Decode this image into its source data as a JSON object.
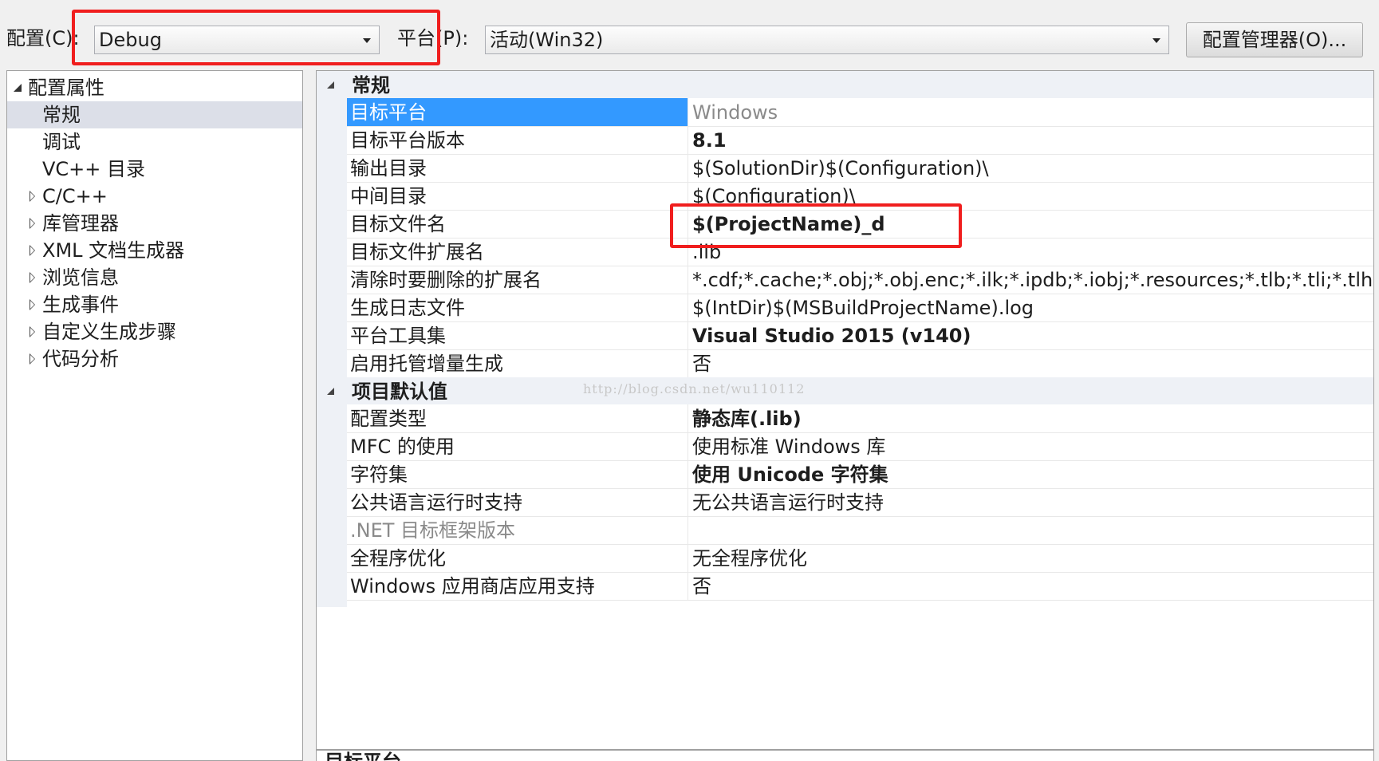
{
  "toolbar": {
    "config_label": "配置(C):",
    "config_value": "Debug",
    "platform_label": "平台(P):",
    "platform_value": "活动(Win32)",
    "config_manager_button": "配置管理器(O)..."
  },
  "tree": {
    "root": "配置属性",
    "items": [
      {
        "label": "常规",
        "expandable": false,
        "selected": true
      },
      {
        "label": "调试",
        "expandable": false
      },
      {
        "label": "VC++ 目录",
        "expandable": false
      },
      {
        "label": "C/C++",
        "expandable": true
      },
      {
        "label": "库管理器",
        "expandable": true
      },
      {
        "label": "XML 文档生成器",
        "expandable": true
      },
      {
        "label": "浏览信息",
        "expandable": true
      },
      {
        "label": "生成事件",
        "expandable": true
      },
      {
        "label": "自定义生成步骤",
        "expandable": true
      },
      {
        "label": "代码分析",
        "expandable": true
      }
    ]
  },
  "grid": {
    "sections": [
      {
        "title": "常规",
        "rows": [
          {
            "name": "目标平台",
            "value": "Windows",
            "selected": true,
            "value_style": "gray"
          },
          {
            "name": "目标平台版本",
            "value": "8.1",
            "value_style": "bold"
          },
          {
            "name": "输出目录",
            "value": "$(SolutionDir)$(Configuration)\\"
          },
          {
            "name": "中间目录",
            "value": "$(Configuration)\\"
          },
          {
            "name": "目标文件名",
            "value": "$(ProjectName)_d",
            "value_style": "bold"
          },
          {
            "name": "目标文件扩展名",
            "value": ".lib"
          },
          {
            "name": "清除时要删除的扩展名",
            "value": "*.cdf;*.cache;*.obj;*.obj.enc;*.ilk;*.ipdb;*.iobj;*.resources;*.tlb;*.tli;*.tlh;*.tmp"
          },
          {
            "name": "生成日志文件",
            "value": "$(IntDir)$(MSBuildProjectName).log"
          },
          {
            "name": "平台工具集",
            "value": "Visual Studio 2015 (v140)",
            "value_style": "bold"
          },
          {
            "name": "启用托管增量生成",
            "value": "否"
          }
        ]
      },
      {
        "title": "项目默认值",
        "rows": [
          {
            "name": "配置类型",
            "value": "静态库(.lib)",
            "value_style": "bold"
          },
          {
            "name": "MFC 的使用",
            "value": "使用标准 Windows 库"
          },
          {
            "name": "字符集",
            "value": "使用 Unicode 字符集",
            "value_style": "bold"
          },
          {
            "name": "公共语言运行时支持",
            "value": "无公共语言运行时支持"
          },
          {
            "name": ".NET 目标框架版本",
            "value": "",
            "name_style": "gray"
          },
          {
            "name": "全程序优化",
            "value": "无全程序优化"
          },
          {
            "name": "Windows 应用商店应用支持",
            "value": "否"
          }
        ]
      }
    ]
  },
  "watermark": "http://blog.csdn.net/wu110112",
  "description_title": "目标平台",
  "colors": {
    "selection": "#3399ff",
    "highlight_box": "#f01e1e",
    "tree_selection": "#dcdfe8"
  }
}
